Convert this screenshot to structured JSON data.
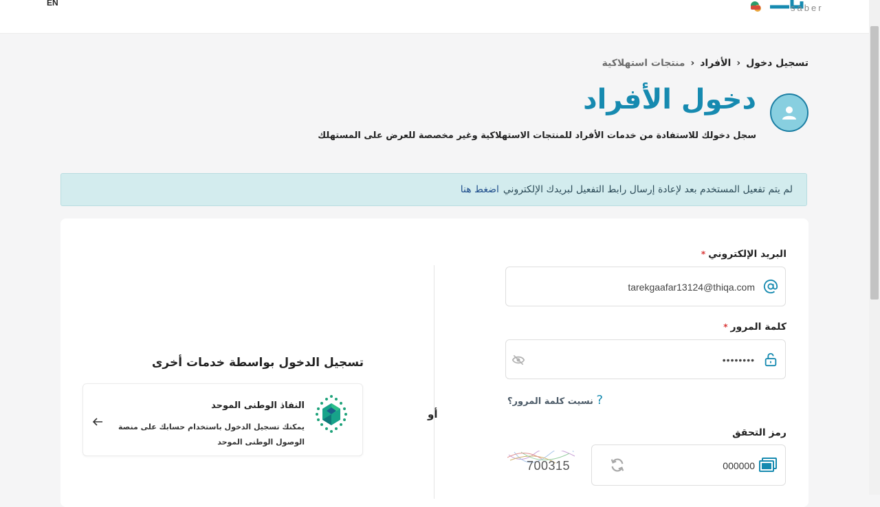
{
  "header": {
    "lang_toggle": "EN",
    "logo_text": "saber"
  },
  "breadcrumb": {
    "items": [
      "تسجيل دخول",
      "الأفراد",
      "منتجات استهلاكية"
    ]
  },
  "page": {
    "title": "دخول الأفراد",
    "subtitle": "سجل دخولك للاستفادة من خدمات الأفراد للمنتجات الاستهلاكية وغير مخصصة للعرض على المستهلك"
  },
  "alert": {
    "message": "لم يتم تفعيل المستخدم بعد لإعادة إرسال رابط التفعيل لبريدك الإلكتروني",
    "link_text": "اضغط هنا"
  },
  "form": {
    "email_label": "البريد الإلكتروني",
    "email_value": "tarekgaafar13124@thiqa.com",
    "password_label": "كلمة المرور",
    "password_value": "••••••••",
    "required_mark": "*",
    "forgot_password": "نسيت كلمة المرور؟",
    "captcha_label": "رمز التحقق",
    "captcha_value": "000000",
    "captcha_image_text": "700315"
  },
  "or_label": "أو",
  "other_services": {
    "title": "تسجيل الدخول بواسطة خدمات أخرى",
    "nafath_title": "النفاذ الوطنى الموحد",
    "nafath_desc": "يمكنك تسجيل الدخول باستخدام حسابك على منصة الوصول الوطنى الموحد"
  },
  "colors": {
    "brand": "#168ab0",
    "alert_bg": "#d3ecee",
    "required": "#d93636",
    "nafath_green": "#1ea27a"
  }
}
